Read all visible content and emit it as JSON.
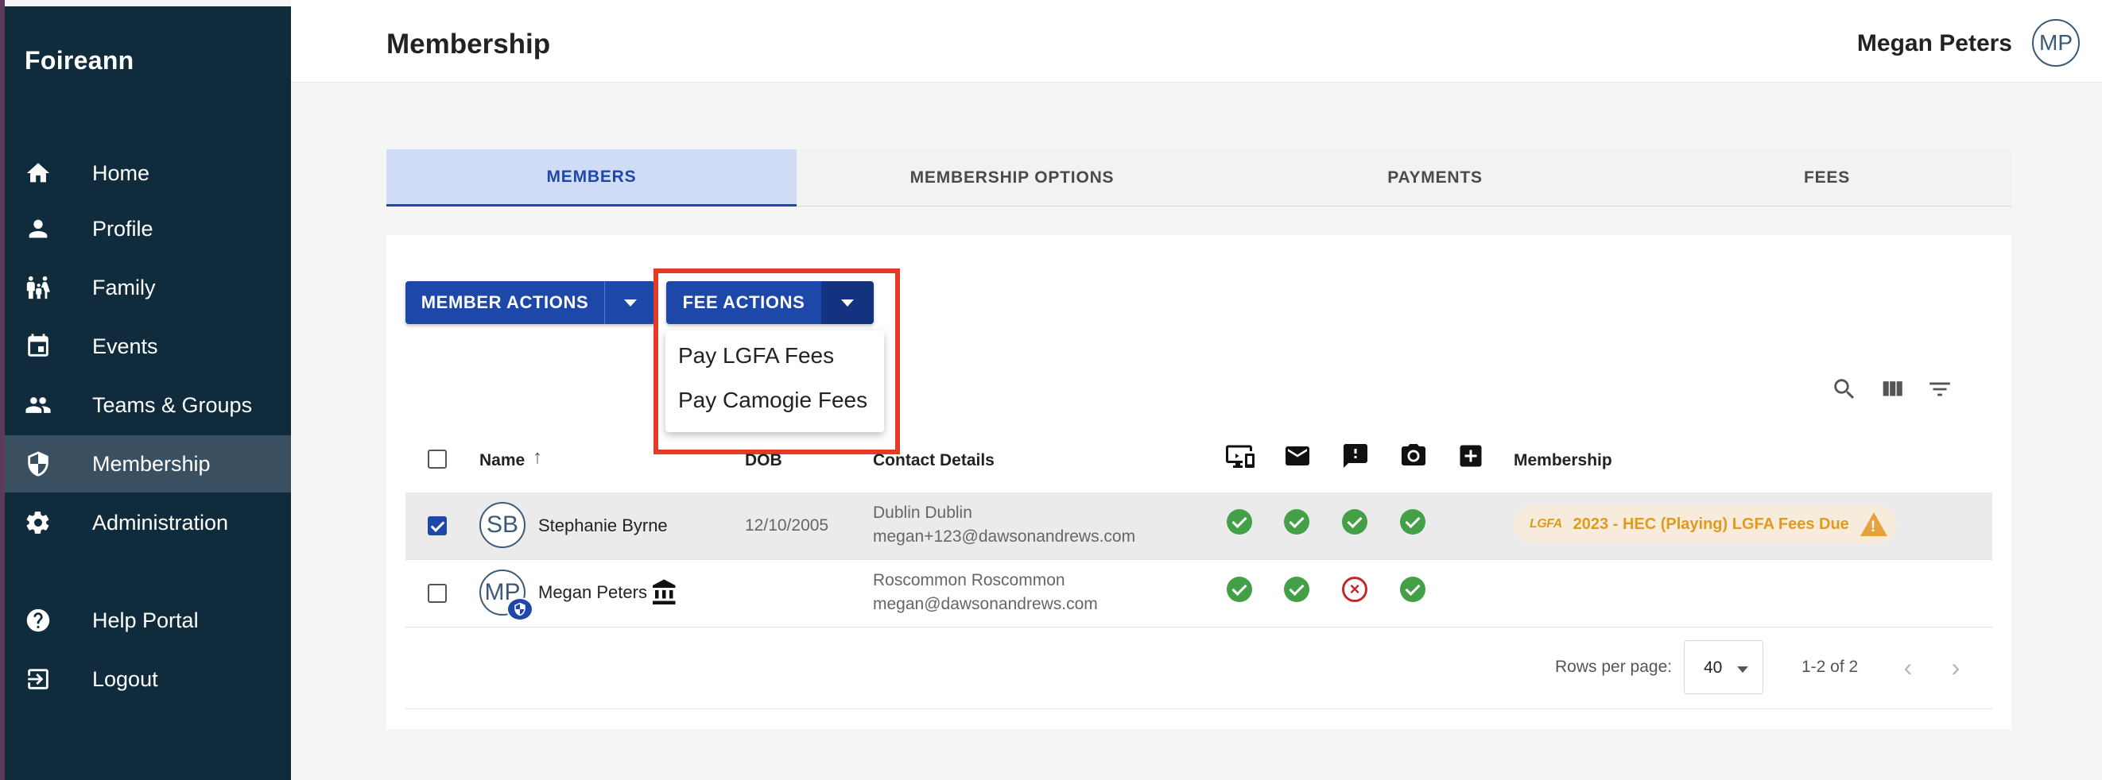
{
  "app": {
    "brand": "Foireann"
  },
  "sidebar": {
    "items": [
      {
        "label": "Home",
        "icon": "home-icon"
      },
      {
        "label": "Profile",
        "icon": "person-icon"
      },
      {
        "label": "Family",
        "icon": "family-icon"
      },
      {
        "label": "Events",
        "icon": "calendar-icon"
      },
      {
        "label": "Teams & Groups",
        "icon": "group-icon"
      },
      {
        "label": "Membership",
        "icon": "shield-icon",
        "active": true
      },
      {
        "label": "Administration",
        "icon": "gear-icon"
      },
      {
        "label": "Help Portal",
        "icon": "help-icon"
      },
      {
        "label": "Logout",
        "icon": "logout-icon"
      }
    ]
  },
  "header": {
    "title": "Membership",
    "user_name": "Megan Peters",
    "user_initials": "MP"
  },
  "tabs": [
    {
      "label": "MEMBERS",
      "active": true
    },
    {
      "label": "MEMBERSHIP OPTIONS"
    },
    {
      "label": "PAYMENTS"
    },
    {
      "label": "FEES"
    }
  ],
  "toolbar": {
    "member_actions": "MEMBER ACTIONS",
    "fee_actions": "FEE ACTIONS",
    "fee_menu": [
      "Pay LGFA Fees",
      "Pay Camogie Fees"
    ],
    "icons": [
      "search-icon",
      "columns-icon",
      "filter-icon"
    ]
  },
  "table": {
    "headers": {
      "name": "Name",
      "dob": "DOB",
      "contact": "Contact Details",
      "membership": "Membership"
    },
    "status_icons": [
      "device-icon",
      "email-icon",
      "alert-icon",
      "camera-icon",
      "medical-icon"
    ],
    "rows": [
      {
        "initials": "SB",
        "name": "Stephanie Byrne",
        "dob": "12/10/2005",
        "contact_line1": "Dublin Dublin",
        "contact_line2": "megan+123@dawsonandrews.com",
        "selected": true,
        "statuses": [
          "ok",
          "ok",
          "ok",
          "ok"
        ],
        "membership_org": "LGFA",
        "membership_label": "2023 - HEC (Playing) LGFA Fees Due"
      },
      {
        "initials": "MP",
        "name": "Megan Peters",
        "dob": "",
        "contact_line1": "Roscommon Roscommon",
        "contact_line2": "megan@dawsonandrews.com",
        "selected": false,
        "statuses": [
          "ok",
          "ok",
          "error",
          "ok"
        ],
        "membership_label": ""
      }
    ]
  },
  "pagination": {
    "rows_per_page_label": "Rows per page:",
    "rows_per_page": "40",
    "range": "1-2 of 2"
  },
  "colors": {
    "sidebar_bg": "#0f2b3c",
    "primary": "#1d47a8",
    "highlight": "#e53a26",
    "success": "#43a047",
    "warning": "#e09a1d"
  }
}
